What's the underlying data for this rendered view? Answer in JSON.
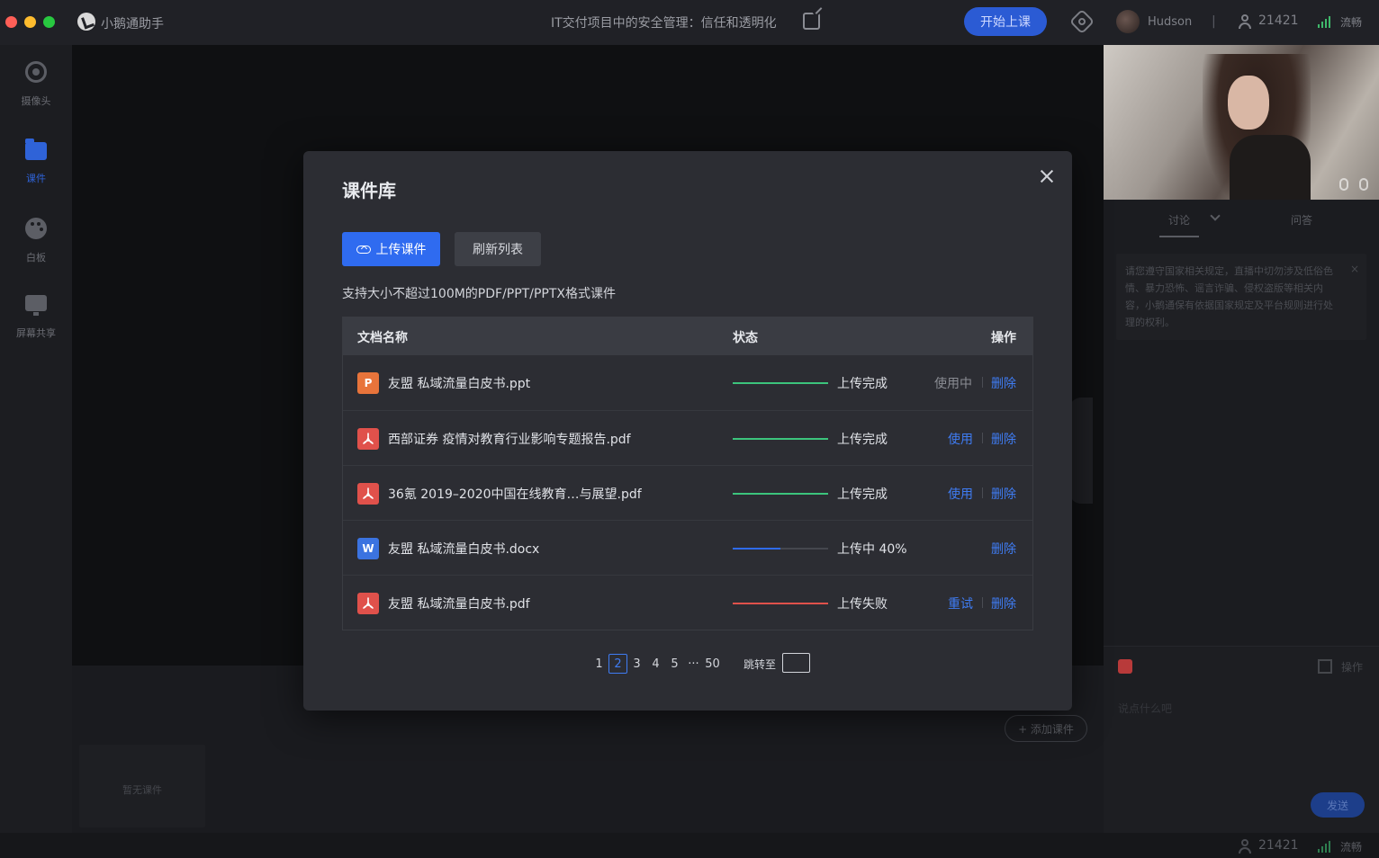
{
  "titlebar": {
    "app_name": "小鹅通助手",
    "course_title": "IT交付项目中的安全管理：信任和透明化",
    "start_button": "开始上课",
    "username": "Hudson",
    "separator": "|",
    "viewer_count": "21421",
    "network_status": "流畅"
  },
  "sidebar": {
    "items": [
      {
        "label": "摄像头",
        "icon": "camera-icon"
      },
      {
        "label": "课件",
        "icon": "folder-icon"
      },
      {
        "label": "白板",
        "icon": "palette-icon"
      },
      {
        "label": "屏幕共享",
        "icon": "screen-share-icon"
      }
    ]
  },
  "stage": {
    "empty_courseware": "暂无课件",
    "add_courseware": "+ 添加课件"
  },
  "right_panel": {
    "tabs": [
      "讨论",
      "问答"
    ],
    "notice": "请您遵守国家相关规定，直播中切勿涉及低俗色情、暴力恐怖、谣言诈骗、侵权盗版等相关内容，小鹅通保有依据国家规定及平台规则进行处理的权利。",
    "notice_close": "×",
    "ops_label": "操作",
    "chat_placeholder": "说点什么吧",
    "send_button": "发送"
  },
  "bottom_bar": {
    "viewer_count": "21421",
    "network_status": "流畅"
  },
  "modal": {
    "title": "课件库",
    "upload_button": "上传课件",
    "refresh_button": "刷新列表",
    "hint": "支持大小不超过100M的PDF/PPT/PPTX格式课件",
    "columns": {
      "name": "文档名称",
      "status": "状态",
      "actions": "操作"
    },
    "rows": [
      {
        "icon_letter": "P",
        "type": "ppt",
        "name": "友盟 私域流量白皮书.ppt",
        "status": "上传完成",
        "progress": 1.0,
        "progress_color": "#3cc47c",
        "action1": "使用中",
        "action2": "删除"
      },
      {
        "icon_letter": "",
        "type": "pdf",
        "name": "西部证券 疫情对教育行业影响专题报告.pdf",
        "status": "上传完成",
        "progress": 1.0,
        "progress_color": "#3cc47c",
        "action1": "使用",
        "action2": "删除"
      },
      {
        "icon_letter": "",
        "type": "pdf",
        "name": "36氪 2019–2020中国在线教育…与展望.pdf",
        "status": "上传完成",
        "progress": 1.0,
        "progress_color": "#3cc47c",
        "action1": "使用",
        "action2": "删除"
      },
      {
        "icon_letter": "W",
        "type": "doc",
        "name": "友盟 私域流量白皮书.docx",
        "status": "上传中 40%",
        "progress": 0.5,
        "progress_color": "#2f6bf0",
        "action1": "",
        "action2": "删除"
      },
      {
        "icon_letter": "",
        "type": "pdf",
        "name": "友盟 私域流量白皮书.pdf",
        "status": "上传失败",
        "progress": 1.0,
        "progress_color": "#e0514b",
        "action1": "重试",
        "action2": "删除"
      }
    ],
    "pagination": {
      "pages": [
        "1",
        "2",
        "3",
        "4",
        "5",
        "···",
        "50"
      ],
      "current": "2",
      "jump_label": "跳转至"
    }
  }
}
